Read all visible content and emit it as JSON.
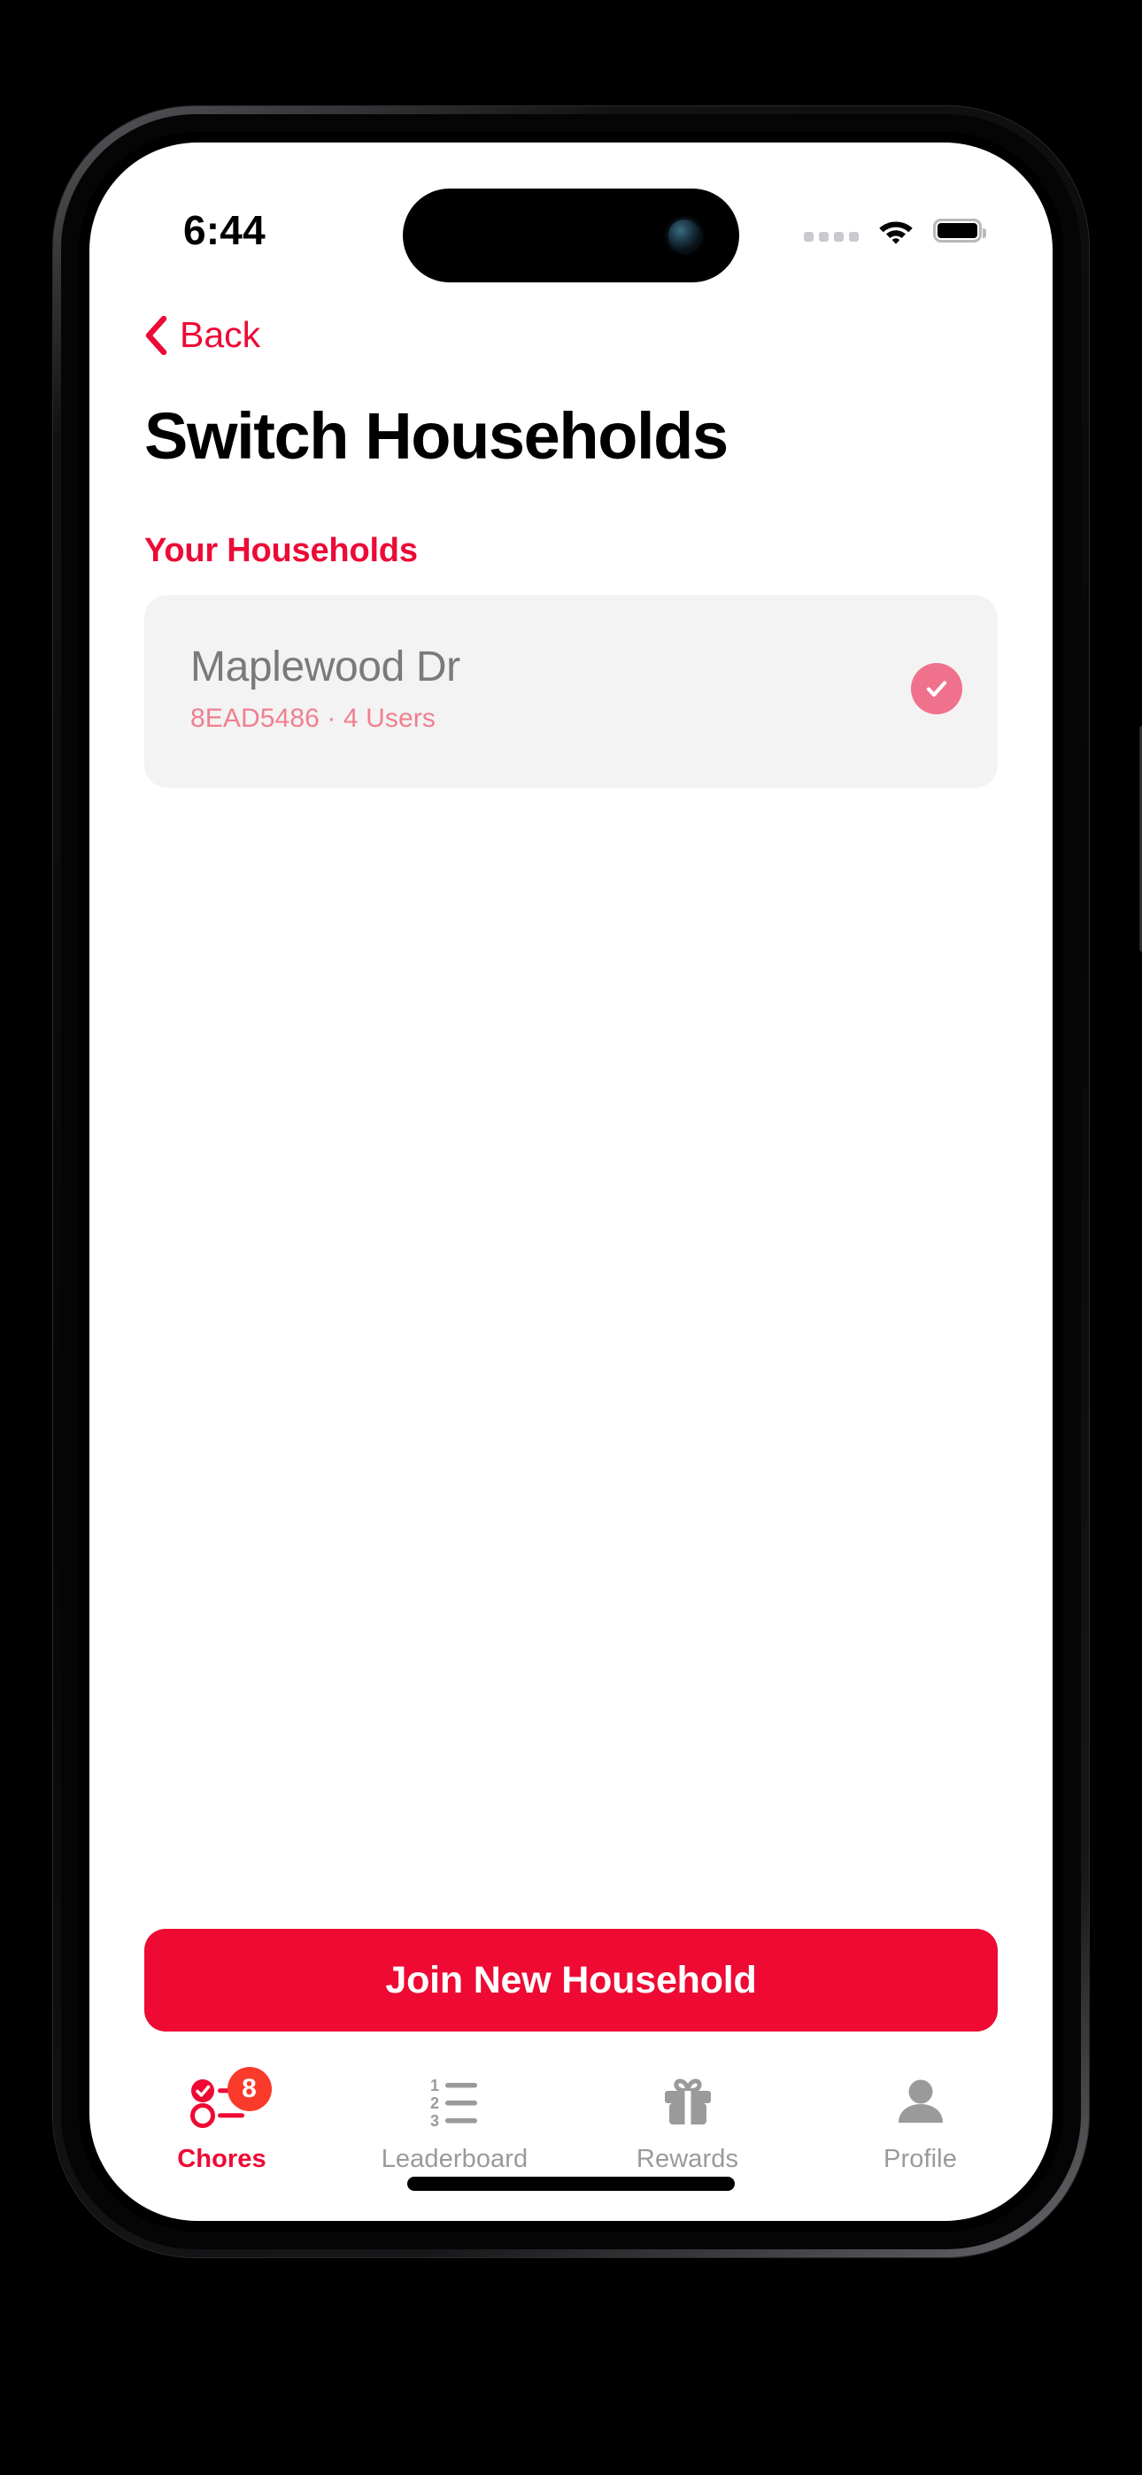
{
  "status_bar": {
    "time": "6:44",
    "cellular_icon": "cellular-dots-icon",
    "wifi_icon": "wifi-icon",
    "battery_icon": "battery-full-icon"
  },
  "nav": {
    "back_label": "Back",
    "back_chevron_icon": "chevron-left-icon"
  },
  "page": {
    "title": "Switch Households",
    "section_header": "Your Households"
  },
  "households": [
    {
      "name": "Maplewood Dr",
      "meta": "8EAD5486 · 4 Users",
      "selected_icon": "check-circle-icon",
      "selected": true
    }
  ],
  "cta": {
    "label": "Join New Household"
  },
  "tabs": [
    {
      "label": "Chores",
      "icon": "checklist-icon",
      "badge": "8",
      "active": true
    },
    {
      "label": "Leaderboard",
      "icon": "ranked-list-icon",
      "badge": "",
      "active": false
    },
    {
      "label": "Rewards",
      "icon": "gift-icon",
      "badge": "",
      "active": false
    },
    {
      "label": "Profile",
      "icon": "person-icon",
      "badge": "",
      "active": false
    }
  ],
  "colors": {
    "brand_red": "#EE0A33",
    "accent_pink": "#F0718C",
    "badge_red": "#FA3B2C",
    "card_bg": "#F3F3F3",
    "muted_text": "#9A9A9A"
  }
}
